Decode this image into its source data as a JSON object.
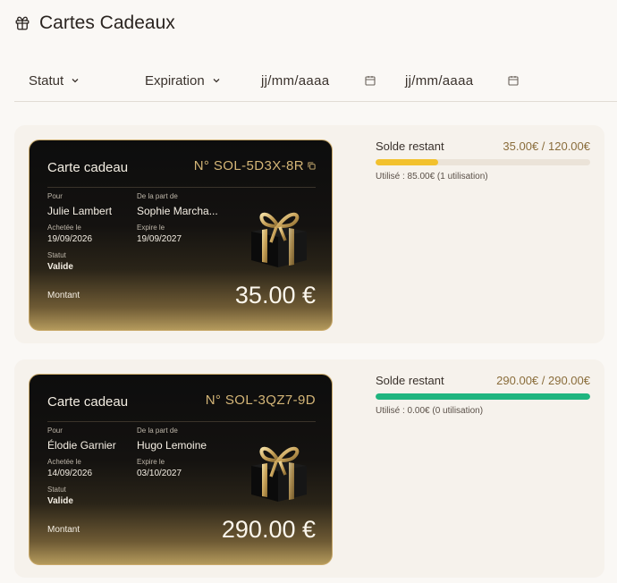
{
  "header": {
    "title": "Cartes Cadeaux",
    "icon": "gift-icon"
  },
  "filters": {
    "status_label": "Statut",
    "expiration_label": "Expiration",
    "date_from_placeholder": "jj/mm/aaaa",
    "date_to_placeholder": "jj/mm/aaaa"
  },
  "cards": [
    {
      "card_title": "Carte cadeau",
      "number": "N° SOL-5D3X-8R",
      "for_label": "Pour",
      "for_value": "Julie Lambert",
      "from_label": "De la part de",
      "from_value": "Sophie Marcha...",
      "bought_label": "Achetée le",
      "bought_value": "19/09/2026",
      "expires_label": "Expire le",
      "expires_value": "19/09/2027",
      "status_label": "Statut",
      "status_value": "Valide",
      "amount_label": "Montant",
      "amount_value": "35.00 €",
      "balance_label": "Solde restant",
      "balance_value": "35.00€ / 120.00€",
      "balance_fraction": 0.29,
      "bar_color": "#f2c12e",
      "used_text": "Utilisé : 85.00€ (1 utilisation)"
    },
    {
      "card_title": "Carte cadeau",
      "number": "N° SOL-3QZ7-9D",
      "for_label": "Pour",
      "for_value": "Élodie Garnier",
      "from_label": "De la part de",
      "from_value": "Hugo Lemoine",
      "bought_label": "Achetée le",
      "bought_value": "14/09/2026",
      "expires_label": "Expire le",
      "expires_value": "03/10/2027",
      "status_label": "Statut",
      "status_value": "Valide",
      "amount_label": "Montant",
      "amount_value": "290.00 €",
      "balance_label": "Solde restant",
      "balance_value": "290.00€ / 290.00€",
      "balance_fraction": 1.0,
      "bar_color": "#1fb57f",
      "used_text": "Utilisé : 0.00€ (0 utilisation)"
    }
  ],
  "colors": {
    "accent_gold": "#c9a96a",
    "page_bg": "#faf8f5",
    "row_bg": "#f6f2ec"
  }
}
